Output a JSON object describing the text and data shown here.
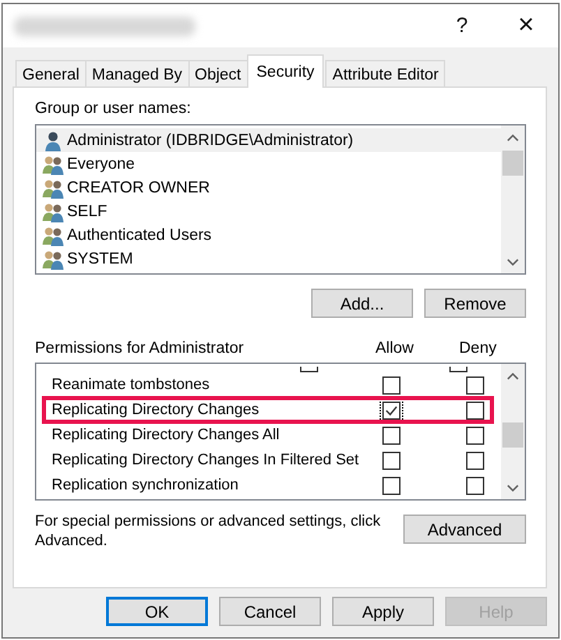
{
  "window": {
    "help_glyph": "?",
    "close_glyph": "×"
  },
  "tabs": [
    {
      "label": "General",
      "selected": false
    },
    {
      "label": "Managed By",
      "selected": false
    },
    {
      "label": "Object",
      "selected": false
    },
    {
      "label": "Security",
      "selected": true
    },
    {
      "label": "Attribute Editor",
      "selected": false
    }
  ],
  "principals": {
    "label": "Group or user names:",
    "items": [
      {
        "name": "Administrator (IDBRIDGE\\Administrator)",
        "kind": "user",
        "selected": true
      },
      {
        "name": "Everyone",
        "kind": "group",
        "selected": false
      },
      {
        "name": "CREATOR OWNER",
        "kind": "group",
        "selected": false
      },
      {
        "name": "SELF",
        "kind": "group",
        "selected": false
      },
      {
        "name": "Authenticated Users",
        "kind": "group",
        "selected": false
      },
      {
        "name": "SYSTEM",
        "kind": "group",
        "selected": false
      }
    ],
    "buttons": [
      "Add...",
      "Remove"
    ]
  },
  "permissions": {
    "label": "Permissions for Administrator",
    "allow_header": "Allow",
    "deny_header": "Deny",
    "rows": [
      {
        "name": "Reanimate tombstones",
        "allow": false,
        "deny": false,
        "highlighted": false
      },
      {
        "name": "Replicating Directory Changes",
        "allow": true,
        "deny": false,
        "highlighted": true
      },
      {
        "name": "Replicating Directory Changes All",
        "allow": false,
        "deny": false,
        "highlighted": false
      },
      {
        "name": "Replicating Directory Changes In Filtered Set",
        "allow": false,
        "deny": false,
        "highlighted": false
      },
      {
        "name": "Replication synchronization",
        "allow": false,
        "deny": false,
        "highlighted": false
      }
    ]
  },
  "advanced": {
    "note": "For special permissions or advanced settings, click Advanced.",
    "button": "Advanced"
  },
  "footer_buttons": [
    {
      "label": "OK",
      "kind": "default",
      "disabled": false
    },
    {
      "label": "Cancel",
      "kind": "normal",
      "disabled": false
    },
    {
      "label": "Apply",
      "kind": "normal",
      "disabled": false
    },
    {
      "label": "Help",
      "kind": "normal",
      "disabled": true
    }
  ]
}
